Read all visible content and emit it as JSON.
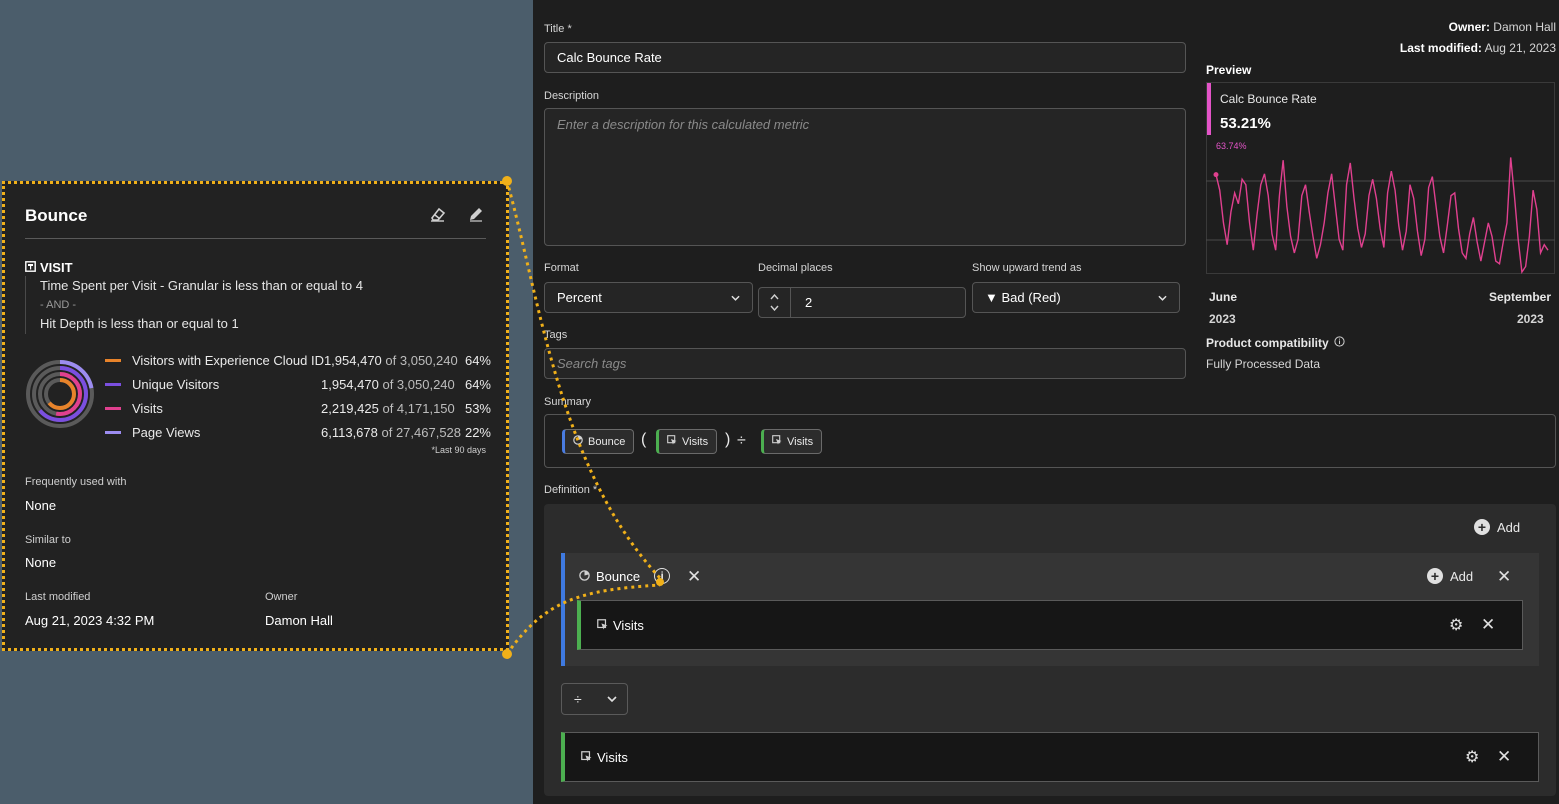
{
  "popover": {
    "title": "Bounce",
    "segment": {
      "container": "VISIT",
      "rule1": "Time Spent per Visit - Granular is less than or equal to 4",
      "joiner": "- AND -",
      "rule2": "Hit Depth is less than or equal to 1"
    },
    "stats": [
      {
        "label": "Visitors with Experience Cloud ID",
        "value": "1,954,470",
        "of": "of 3,050,240",
        "pct": "64%",
        "color": "#e8832a"
      },
      {
        "label": "Unique Visitors",
        "value": "1,954,470",
        "of": "of 3,050,240",
        "pct": "64%",
        "color": "#7b4fe0"
      },
      {
        "label": "Visits",
        "value": "2,219,425",
        "of": "of 4,171,150",
        "pct": "53%",
        "color": "#e0408f"
      },
      {
        "label": "Page Views",
        "value": "6,113,678",
        "of": "of 27,467,528",
        "pct": "22%",
        "color": "#9c8cf0"
      }
    ],
    "footnote": "*Last 90 days",
    "frequently_used_label": "Frequently used with",
    "frequently_used_value": "None",
    "similar_label": "Similar to",
    "similar_value": "None",
    "last_modified_label": "Last modified",
    "last_modified_value": "Aug 21, 2023 4:32 PM",
    "owner_label": "Owner",
    "owner_value": "Damon Hall"
  },
  "editor": {
    "title_label": "Title",
    "required_mark": "*",
    "title_value": "Calc Bounce Rate",
    "owner_label": "Owner:",
    "owner_value": "Damon Hall",
    "modified_label": "Last modified:",
    "modified_value": "Aug 21, 2023",
    "description_label": "Description",
    "description_placeholder": "Enter a description for this calculated metric",
    "format_label": "Format",
    "format_value": "Percent",
    "decimal_label": "Decimal places",
    "decimal_value": "2",
    "trend_label": "Show upward trend as",
    "trend_value": "▼ Bad (Red)",
    "tags_label": "Tags",
    "tags_placeholder": "Search tags",
    "summary_label": "Summary",
    "definition_label": "Definition",
    "add_label": "Add"
  },
  "preview": {
    "title": "Preview",
    "metric_name": "Calc Bounce Rate",
    "metric_value": "53.21%",
    "max_label": "63.74%",
    "start_month": "June",
    "start_year": "2023",
    "end_month": "September",
    "end_year": "2023",
    "compat_label": "Product compatibility",
    "compat_value": "Fully Processed Data",
    "line_color": "#e0408f",
    "values": [
      63.7,
      58,
      46,
      38,
      50,
      57,
      53,
      62,
      60,
      46,
      36,
      49,
      60,
      64,
      56,
      42,
      36,
      56,
      69,
      52,
      41,
      35,
      40,
      56,
      60,
      50,
      41,
      33,
      38,
      46,
      57,
      64,
      52,
      40,
      36,
      60,
      68,
      55,
      44,
      37,
      42,
      56,
      62,
      55,
      44,
      37,
      57,
      65,
      58,
      45,
      36,
      43,
      60,
      55,
      43,
      34,
      40,
      59,
      63,
      52,
      41,
      35,
      45,
      56,
      57,
      44,
      35,
      33,
      42,
      48,
      39,
      32,
      39,
      46,
      41,
      32,
      31,
      39,
      46,
      70,
      56,
      40,
      28,
      30,
      41,
      58,
      51,
      35,
      38,
      36
    ]
  },
  "summary": {
    "chips": [
      {
        "type": "segment",
        "label": "Bounce"
      },
      {
        "type": "metric",
        "label": "Visits"
      },
      {
        "type": "metric",
        "label": "Visits"
      }
    ],
    "open_paren": "(",
    "close_paren": ")",
    "divide": "÷"
  },
  "definition": {
    "container_label": "Bounce",
    "metric1": "Visits",
    "operator": "÷",
    "metric2": "Visits"
  }
}
